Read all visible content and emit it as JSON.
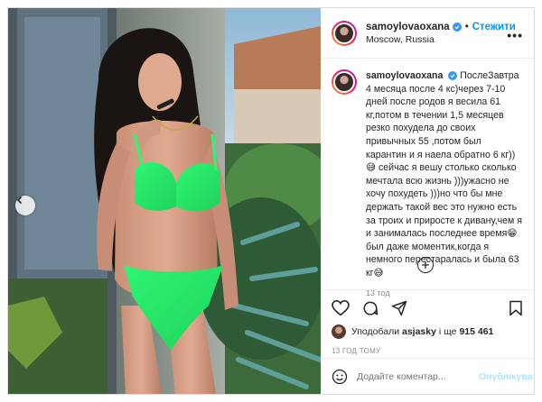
{
  "post": {
    "username": "samoylovaoxana",
    "follow_label": "Стежити",
    "separator": "•",
    "location": "Moscow, Russia",
    "more_label": "•••",
    "caption": "ПослеЗавтра 4 месяца после 4 кс)через 7-10 дней после родов я весила 61 кг,потом в течении 1,5 месяцев резко похудела до своих привычных 55 ,потом был карантин и я наела обратно 6 кг))😅 сейчас я вешу столько сколько мечтала всю жизнь )))ужасно не хочу похудеть )))но что бы мне держать такой вес это нужно есть за троих и приросте к дивану,чем я и занималась последнее время😁был даже моментик,когда я немного перестаралась и была 63 кг😅",
    "caption_time": "13 тод",
    "likes_prefix": "Уподобали",
    "likes_user": "asjasky",
    "likes_middle": "і ще",
    "likes_count": "915 461",
    "post_time": "13 ГОД ТОМУ",
    "comment_placeholder": "Додайте коментар...",
    "publish_label": "Опублікувати"
  },
  "icons": {
    "prev": "chevron-left-icon",
    "verified": "verified-badge-icon",
    "like": "heart-icon",
    "comment": "comment-icon",
    "share": "share-icon",
    "save": "bookmark-icon",
    "emoji": "smiley-icon",
    "load_more": "plus-circle-icon"
  },
  "colors": {
    "link": "#0095f6",
    "verified": "#3897f0",
    "muted": "#8e8e8e",
    "publish_disabled": "#b2dffc",
    "swimsuit": "#39f07a"
  }
}
